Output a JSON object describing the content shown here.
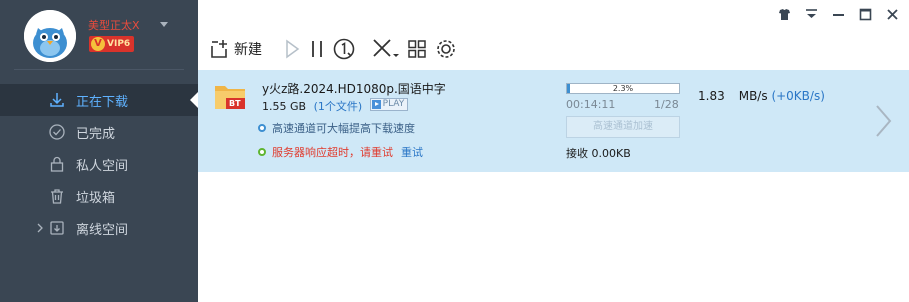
{
  "user": {
    "name": "美型正太X",
    "vip_label": "VIP6",
    "vip_crown": "V"
  },
  "sidebar": {
    "items": [
      {
        "label": "正在下载",
        "icon": "download-arrow-icon"
      },
      {
        "label": "已完成",
        "icon": "check-circle-icon"
      },
      {
        "label": "私人空间",
        "icon": "lock-icon"
      },
      {
        "label": "垃圾箱",
        "icon": "trash-icon"
      },
      {
        "label": "离线空间",
        "icon": "cloud-download-icon"
      }
    ]
  },
  "window_controls": [
    "skin-icon",
    "menu-icon",
    "minimize-icon",
    "maximize-icon",
    "close-icon"
  ],
  "toolbar": {
    "new_label": "新建",
    "buttons": [
      "new-icon",
      "start-icon",
      "pause-icon",
      "speed-limit-icon",
      "delete-icon",
      "grid-icon",
      "settings-icon"
    ]
  },
  "task": {
    "name": "y火z路.2024.HD1080p.国语中字",
    "size": "1.55 GB",
    "file_count": "(1个文件)",
    "play_label": "PLAY",
    "folder_badge": "BT",
    "fast_channel_tip": "高速通道可大幅提高下载速度",
    "error_text": "服务器响应超时，请重试",
    "retry_label": "重试",
    "progress_percent": 2.3,
    "progress_text": "2.3%",
    "time_left": "00:14:11",
    "pieces": "1/28",
    "accel_button": "高速通道加速",
    "received": "接收 0.00KB",
    "speed": "1.83",
    "speed_unit": "MB/s",
    "speed_extra": "(+0KB/s)"
  },
  "colors": {
    "sidebar_bg": "#3a4653",
    "active_text": "#5fb2ff",
    "row_highlight": "#cfe8f7",
    "error_red": "#e03b2e",
    "link_blue": "#2a76c6",
    "vip_red": "#d9332b"
  }
}
